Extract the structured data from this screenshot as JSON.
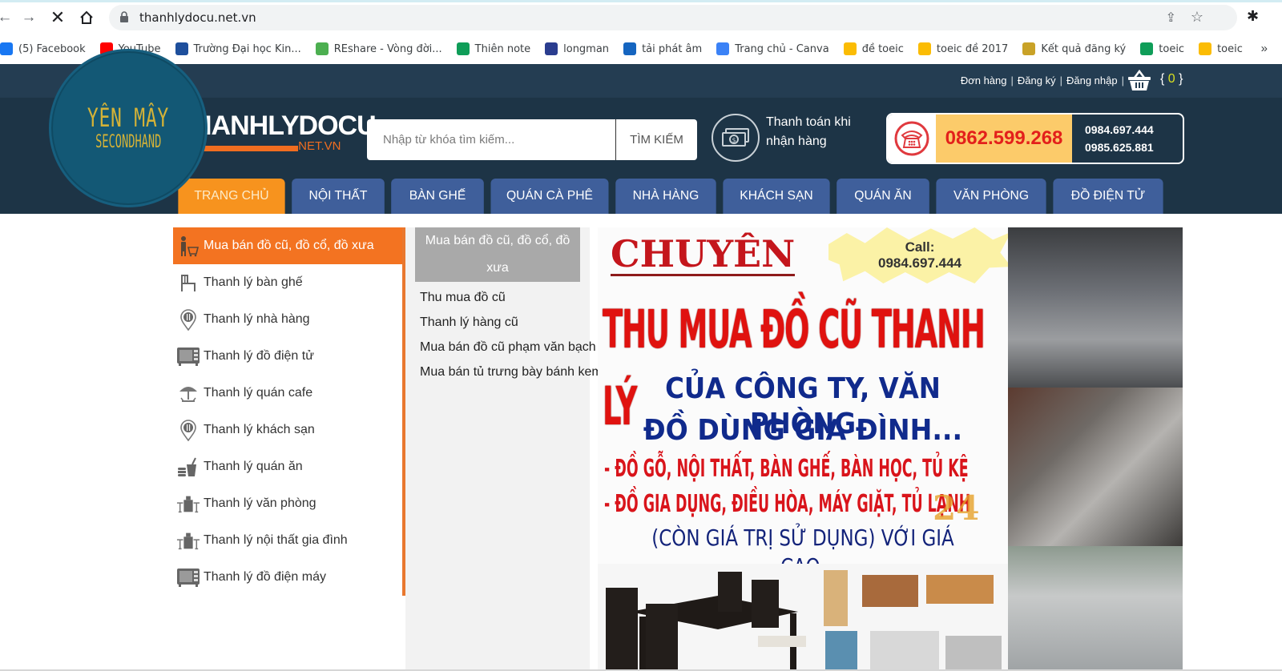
{
  "browser": {
    "url": "thanhlydocu.net.vn",
    "nav_icons": [
      "back-icon",
      "forward-icon",
      "stop-icon",
      "home-icon"
    ],
    "bookmarks": [
      {
        "label": "(5) Facebook",
        "icon": "facebook-icon",
        "color": "#1877f2"
      },
      {
        "label": "YouTube",
        "icon": "youtube-icon",
        "color": "#ff0000"
      },
      {
        "label": "Trường Đại học Kin...",
        "icon": "university-icon",
        "color": "#1e4f9c"
      },
      {
        "label": "REshare - Vòng đời...",
        "icon": "reshare-icon",
        "color": "#4caf50"
      },
      {
        "label": "Thiên note",
        "icon": "google-classroom-icon",
        "color": "#0f9d58"
      },
      {
        "label": "longman",
        "icon": "longman-icon",
        "color": "#2a3d8f"
      },
      {
        "label": "tải phát âm",
        "icon": "forvo-icon",
        "color": "#1565c0"
      },
      {
        "label": "Trang chủ - Canva",
        "icon": "canva-icon",
        "color": "#3b82f6"
      },
      {
        "label": "đề toeic",
        "icon": "google-drive-icon",
        "color": "#fbbc04"
      },
      {
        "label": "toeic đề 2017",
        "icon": "google-drive-icon",
        "color": "#fbbc04"
      },
      {
        "label": "Kết quả đăng ký",
        "icon": "iig-icon",
        "color": "#c9a227"
      },
      {
        "label": "toeic",
        "icon": "google-classroom-icon",
        "color": "#0f9d58"
      },
      {
        "label": "toeic",
        "icon": "google-drive-icon",
        "color": "#fbbc04"
      }
    ],
    "more": "»"
  },
  "header": {
    "top_links": [
      "Đơn hàng",
      "Đăng ký",
      "Đăng nhập"
    ],
    "cart_count_prefix": "{",
    "cart_count": "0",
    "cart_count_suffix": "}",
    "badge_line1": "YÊN MÂY",
    "badge_line2": "SECONDHAND",
    "logo_name": "HANHLYDOCU",
    "logo_tld": ".NET.VN",
    "search_placeholder": "Nhập từ khóa tìm kiếm...",
    "search_button": "TÌM KIẾM",
    "cod_line1": "Thanh toán khi",
    "cod_line2": "nhận hàng",
    "hotline_main": "0862.599.268",
    "hotline_alt1": "0984.697.444",
    "hotline_alt2": "0985.625.881"
  },
  "nav": {
    "tabs": [
      {
        "label": "TRANG CHỦ",
        "active": true
      },
      {
        "label": "NỘI THẤT"
      },
      {
        "label": "BÀN GHẾ"
      },
      {
        "label": "QUÁN CÀ PHÊ"
      },
      {
        "label": "NHÀ HÀNG"
      },
      {
        "label": "KHÁCH SẠN"
      },
      {
        "label": "QUÁN ĂN"
      },
      {
        "label": "VĂN PHÒNG"
      },
      {
        "label": "ĐỒ ĐIỆN TỬ"
      }
    ]
  },
  "sidebar": {
    "items": [
      {
        "label": "Mua bán đồ cũ, đồ cổ, đồ xưa",
        "icon": "shopper-cart-icon",
        "active": true
      },
      {
        "label": "Thanh lý bàn ghế",
        "icon": "chair-icon"
      },
      {
        "label": "Thanh lý nhà hàng",
        "icon": "restaurant-pin-icon"
      },
      {
        "label": "Thanh lý đồ điện tử",
        "icon": "microwave-icon"
      },
      {
        "label": "Thanh lý quán cafe",
        "icon": "umbrella-table-icon"
      },
      {
        "label": "Thanh lý khách sạn",
        "icon": "restaurant-pin-icon"
      },
      {
        "label": "Thanh lý quán ăn",
        "icon": "fast-food-icon"
      },
      {
        "label": "Thanh lý văn phòng",
        "icon": "office-desk-icon"
      },
      {
        "label": "Thanh lý nội thất gia đình",
        "icon": "office-desk-icon"
      },
      {
        "label": "Thanh lý đồ điện máy",
        "icon": "microwave-icon"
      }
    ]
  },
  "submenu": {
    "heading": "Mua bán đồ cũ, đồ cổ, đồ xưa",
    "links": [
      "Thu mua đồ cũ",
      "Thanh lý hàng cũ",
      "Mua bán đồ cũ phạm văn bạch",
      "Mua bán tủ trưng bày bánh kem"
    ]
  },
  "banner": {
    "chuyen": "CHUYÊN",
    "call_label": "Call:",
    "call_number": "0984.697.444",
    "line1": "THU MUA ĐỒ CŨ THANH LÝ",
    "line2": "CỦA CÔNG TY, VĂN PHÒNG",
    "line3": "ĐỒ DÙNG GIA ĐÌNH...",
    "line4": "- ĐỒ GỖ, NỘI THẤT, BÀN GHẾ, BÀN HỌC, TỦ KỆ",
    "line5": "- ĐỒ GIA DỤNG, ĐIỀU HÒA, MÁY GIẶT, TỦ LẠNH",
    "line6": "(CÒN GIÁ TRỊ SỬ DỤNG) VỚI GIÁ CAO.",
    "watermark": "24"
  }
}
